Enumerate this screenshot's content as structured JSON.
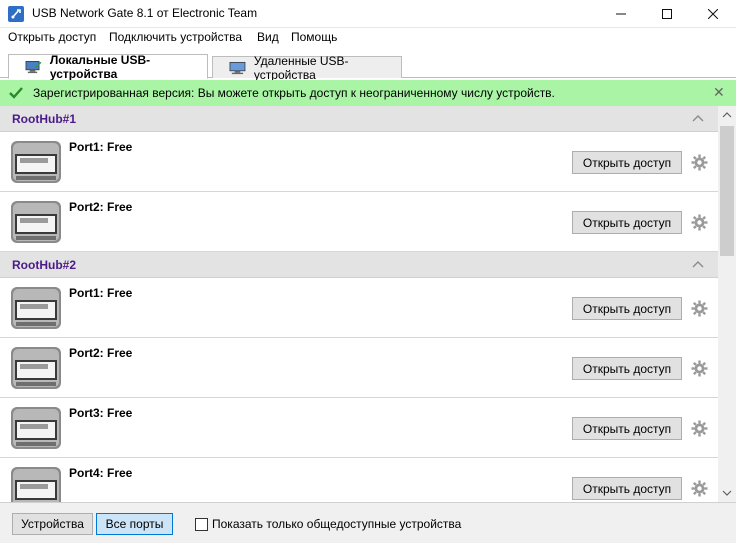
{
  "window": {
    "title": "USB Network Gate 8.1 от Electronic Team",
    "minimize": "—",
    "maximize": "☐",
    "close": "✕"
  },
  "menu": {
    "items": [
      {
        "label": "Открыть доступ"
      },
      {
        "label": "Подключить устройства"
      },
      {
        "label": "Вид"
      },
      {
        "label": "Помощь"
      }
    ]
  },
  "tabs": [
    {
      "label": "Локальные USB-устройства",
      "active": true,
      "icon": "local-computer-icon"
    },
    {
      "label": "Удаленные USB-устройства",
      "active": false,
      "icon": "remote-computer-icon"
    }
  ],
  "notice": {
    "text": "Зарегистрированная версия: Вы можете открыть доступ к неограниченному числу устройств.",
    "close": "✕",
    "color": "#a9f5a5"
  },
  "hubs": [
    {
      "name": "RootHub#1",
      "ports": [
        {
          "label": "Port1: Free",
          "button": "Открыть доступ"
        },
        {
          "label": "Port2: Free",
          "button": "Открыть доступ"
        }
      ]
    },
    {
      "name": "RootHub#2",
      "ports": [
        {
          "label": "Port1: Free",
          "button": "Открыть доступ"
        },
        {
          "label": "Port2: Free",
          "button": "Открыть доступ"
        },
        {
          "label": "Port3: Free",
          "button": "Открыть доступ"
        },
        {
          "label": "Port4: Free",
          "button": "Открыть доступ"
        }
      ]
    }
  ],
  "bottom": {
    "devices_button": "Устройства",
    "all_ports_button": "Все порты",
    "checkbox_label": "Показать только общедоступные устройства",
    "checkbox_checked": false
  },
  "colors": {
    "hub_name": "#4b1a8a",
    "accent": "#0078d7"
  }
}
